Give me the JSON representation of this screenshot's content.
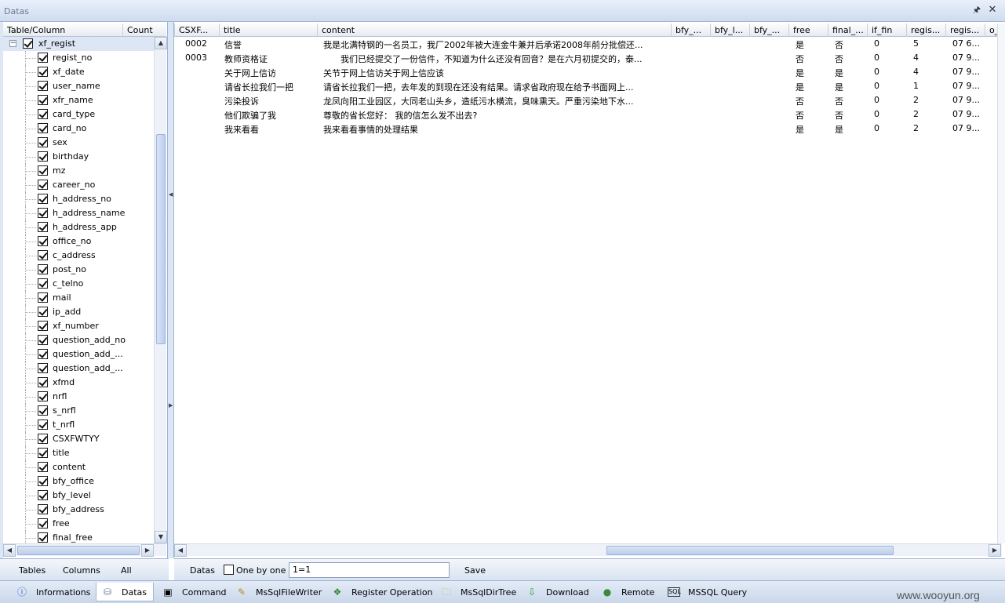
{
  "window": {
    "title": "Datas"
  },
  "left": {
    "headers": {
      "col1": "Table/Column",
      "col2": "Count"
    },
    "root": "xf_regist",
    "columns": [
      "regist_no",
      "xf_date",
      "user_name",
      "xfr_name",
      "card_type",
      "card_no",
      "sex",
      "birthday",
      "mz",
      "career_no",
      "h_address_no",
      "h_address_name",
      "h_address_app",
      "office_no",
      "c_address",
      "post_no",
      "c_telno",
      "mail",
      "ip_add",
      "xf_number",
      "question_add_no",
      "question_add_...",
      "question_add_...",
      "xfmd",
      "nrfl",
      "s_nrfl",
      "t_nrfl",
      "CSXFWTYY",
      "title",
      "content",
      "bfy_office",
      "bfy_level",
      "bfy_address",
      "free",
      "final_free"
    ],
    "toolbar": {
      "tables": "Tables",
      "columns": "Columns",
      "all": "All"
    }
  },
  "grid": {
    "headers": [
      "CSXF...",
      "title",
      "content",
      "bfy_...",
      "bfy_l...",
      "bfy_...",
      "free",
      "final_...",
      "if_fin",
      "regis...",
      "regis...",
      "o_"
    ],
    "rows": [
      [
        "0002",
        "信誉",
        "我是北满特钢的一名员工，我厂2002年被大连金牛兼并后承诺2008年前分批偿还...",
        "",
        "",
        "",
        "是",
        "否",
        "0",
        "5",
        "07 6..."
      ],
      [
        "0003",
        "教师资格证",
        "　　我们已经提交了一份信件，不知道为什么还没有回音？是在六月初提交的，泰...",
        "",
        "",
        "",
        "否",
        "否",
        "0",
        "4",
        "07 9..."
      ],
      [
        "",
        "关于网上信访",
        "关节于网上信访关于网上信应该",
        "",
        "",
        "",
        "是",
        "是",
        "0",
        "4",
        "07 9..."
      ],
      [
        "",
        "请省长拉我们一把",
        "请省长拉我们一把，去年发的到现在还没有结果。请求省政府现在给予书面网上...",
        "",
        "",
        "",
        "是",
        "是",
        "0",
        "1",
        "07 9..."
      ],
      [
        "",
        "污染投诉",
        "龙凤向阳工业园区，大同老山头乡，造纸污水横流，臭味熏天。严重污染地下水...",
        "",
        "",
        "",
        "否",
        "否",
        "0",
        "2",
        "07 9..."
      ],
      [
        "",
        "他们欺骗了我",
        "尊敬的省长您好：  我的信怎么发不出去?",
        "",
        "",
        "",
        "否",
        "否",
        "0",
        "2",
        "07 9..."
      ],
      [
        "",
        "我来看看",
        "我来看看事情的处理结果",
        "",
        "",
        "",
        "是",
        "是",
        "0",
        "2",
        "07 9..."
      ]
    ]
  },
  "toolbar": {
    "datas": "Datas",
    "onebyone": "One by one",
    "where": "1=1",
    "save": "Save"
  },
  "tabs": [
    {
      "label": "Informations",
      "icon": "info-icon"
    },
    {
      "label": "Datas",
      "icon": "database-icon"
    },
    {
      "label": "Command",
      "icon": "console-icon"
    },
    {
      "label": "MsSqlFileWriter",
      "icon": "pencil-icon"
    },
    {
      "label": "Register Operation",
      "icon": "register-icon"
    },
    {
      "label": "MsSqlDirTree",
      "icon": "folder-icon"
    },
    {
      "label": "Download",
      "icon": "download-icon"
    },
    {
      "label": "Remote",
      "icon": "globe-icon"
    },
    {
      "label": "MSSQL Query",
      "icon": "sql-icon"
    }
  ],
  "watermark": "www.wooyun.org"
}
